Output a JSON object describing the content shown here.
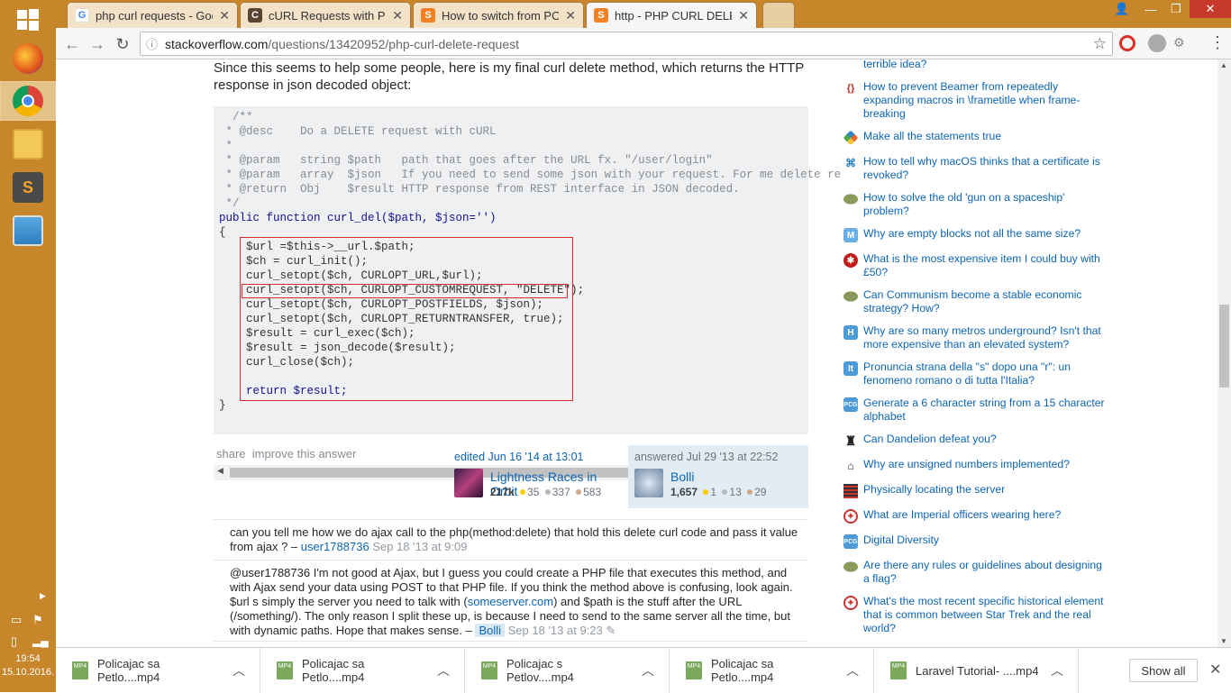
{
  "taskbar": {
    "time": "19:54",
    "date": "15.10.2016."
  },
  "tabs": [
    {
      "label": "php curl requests - Goog",
      "favicon": "google-icon",
      "color": "#4285f4",
      "glyph": "G"
    },
    {
      "label": "cURL Requests with PHP",
      "favicon": "codeigniter-icon",
      "color": "#5a4330",
      "glyph": "C"
    },
    {
      "label": "How to switch from POST",
      "favicon": "stackoverflow-icon",
      "color": "#f48024",
      "glyph": "S"
    },
    {
      "label": "http - PHP CURL DELETE",
      "favicon": "stackoverflow-icon",
      "color": "#f48024",
      "glyph": "S"
    }
  ],
  "omnibox": {
    "host": "stackoverflow.com",
    "path": "/questions/13420952/php-curl-delete-request"
  },
  "answer": {
    "intro": "Since this seems to help some people, here is my final curl delete method, which returns the HTTP response in json decoded object:",
    "code": [
      "  /**",
      " * @desc    Do a DELETE request with cURL",
      " *",
      " * @param   string $path   path that goes after the URL fx. \"/user/login\"",
      " * @param   array  $json   If you need to send some json with your request. For me delete re",
      " * @return  Obj    $result HTTP response from REST interface in JSON decoded.",
      " */",
      "public function curl_del($path, $json='')",
      "{",
      "    $url =$this->__url.$path;",
      "    $ch = curl_init();",
      "    curl_setopt($ch, CURLOPT_URL,$url);",
      "    curl_setopt($ch, CURLOPT_CUSTOMREQUEST, \"DELETE\");",
      "    curl_setopt($ch, CURLOPT_POSTFIELDS, $json);",
      "    curl_setopt($ch, CURLOPT_RETURNTRANSFER, true);",
      "    $result = curl_exec($ch);",
      "    $result = json_decode($result);",
      "    curl_close($ch);",
      "",
      "    return $result;",
      "}"
    ],
    "share": "share",
    "improve": "improve this answer",
    "edited": {
      "action": "edited Jun 16 '14 at 13:01",
      "user": "Lightness Races in Orbit",
      "rep": "217k",
      "gold": "35",
      "silver": "337",
      "bronze": "583"
    },
    "answered": {
      "action": "answered Jul 29 '13 at 22:52",
      "user": "Bolli",
      "rep": "1,657",
      "gold": "1",
      "silver": "13",
      "bronze": "29"
    }
  },
  "comments": [
    {
      "text": "can you tell me how we do ajax call to the php(method:delete) that hold this delete curl code and pass it value from ajax ? –",
      "user": "user1788736",
      "date": "Sep 18 '13 at 9:09"
    },
    {
      "text_a": "@user1788736 I'm not good at Ajax, but I guess you could create a PHP file that executes this method, and with Ajax send your data using POST to that PHP file. If you think the method above is confusing, look again. $url s simply the server you need to talk with (",
      "link1": "someserver.com",
      "text_b": ") and $path is the stuff after the URL (/something/). The only reason I split these up, is because I need to send to the same server all the time, but with dynamic paths. Hope that makes sense. –",
      "user": "Bolli",
      "date": "Sep 18 '13 at 9:23"
    }
  ],
  "hot_questions": [
    {
      "title": "terrible idea?",
      "icon": "site-icon",
      "color": "#ffffff"
    },
    {
      "title": "How to prevent Beamer from repeatedly expanding macros in \\frametitle when frame-breaking",
      "icon": "tex-icon",
      "color": "#ffffff"
    },
    {
      "title": "Make all the statements true",
      "icon": "puzzling-icon",
      "color": "#ffffff"
    },
    {
      "title": "How to tell why macOS thinks that a certificate is revoked?",
      "icon": "apple-icon",
      "color": "#ffffff"
    },
    {
      "title": "How to solve the old 'gun on a spaceship' problem?",
      "icon": "worldbuilding-icon",
      "color": "#ffffff"
    },
    {
      "title": "Why are empty blocks not all the same size?",
      "icon": "meta-icon",
      "color": "#ffffff"
    },
    {
      "title": "What is the most expensive item I could buy with £50?",
      "icon": "gaming-icon",
      "color": "#ffffff"
    },
    {
      "title": "Can Communism become a stable economic strategy? How?",
      "icon": "worldbuilding-icon",
      "color": "#ffffff"
    },
    {
      "title": "Why are so many metros underground? Isn't that more expensive than an elevated system?",
      "icon": "travel-icon",
      "color": "#ffffff"
    },
    {
      "title": "Pronuncia strana della \"s\" dopo una \"r\": un fenomeno romano o di tutta l'Italia?",
      "icon": "italian-icon",
      "color": "#ffffff"
    },
    {
      "title": "Generate a 6 character string from a 15 character alphabet",
      "icon": "codegolf-icon",
      "color": "#ffffff"
    },
    {
      "title": "Can Dandelion defeat you?",
      "icon": "chess-icon",
      "color": "#ffffff"
    },
    {
      "title": "Why are unsigned numbers implemented?",
      "icon": "retro-icon",
      "color": "#ffffff"
    },
    {
      "title": "Physically locating the server",
      "icon": "serverfault-icon",
      "color": "#ffffff"
    },
    {
      "title": "What are Imperial officers wearing here?",
      "icon": "scifi-icon",
      "color": "#ffffff"
    },
    {
      "title": "Digital Diversity",
      "icon": "codegolf-icon",
      "color": "#ffffff"
    },
    {
      "title": "Are there any rules or guidelines about designing a flag?",
      "icon": "worldbuilding-icon",
      "color": "#ffffff"
    },
    {
      "title": "What's the most recent specific historical element that is common between Star Trek and the real world?",
      "icon": "scifi-icon",
      "color": "#ffffff"
    }
  ],
  "downloads": [
    {
      "name": "Policajac sa Petlo....mp4",
      "type": "MP4"
    },
    {
      "name": "Policajac sa Petlo....mp4",
      "type": "MP4"
    },
    {
      "name": "Policajac s Petlov....mp4",
      "type": "MP4"
    },
    {
      "name": "Policajac sa Petlo....mp4",
      "type": "MP4"
    },
    {
      "name": "Laravel Tutorial- ....mp4",
      "type": "MP4"
    }
  ],
  "show_all": "Show all"
}
